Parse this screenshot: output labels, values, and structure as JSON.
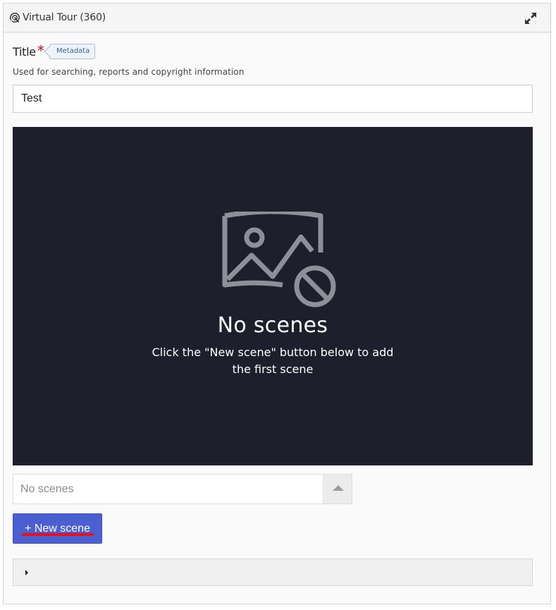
{
  "panel": {
    "title": "Virtual Tour (360)",
    "header_icon": "virtual-tour-icon",
    "expand_icon": "expand-arrows-icon"
  },
  "form": {
    "title_label": "Title",
    "required_mark": "*",
    "metadata_badge": "Metadata",
    "help_text": "Used for searching, reports and copyright information",
    "title_value": "Test"
  },
  "viewer": {
    "placeholder_icon": "no-image-icon",
    "empty_title": "No scenes",
    "empty_description": "Click the \"New scene\" button below to add the first scene"
  },
  "scene_selector": {
    "selected": "No scenes",
    "toggle_icon": "caret-up-icon"
  },
  "actions": {
    "new_scene_label": "+ New scene"
  },
  "collapsible": {
    "caret_icon": "caret-right-icon"
  },
  "colors": {
    "viewer_bg": "#1d1f2d",
    "primary_button": "#4b5fd0",
    "required": "#d0021b",
    "annotation_underline": "#e4121d"
  }
}
